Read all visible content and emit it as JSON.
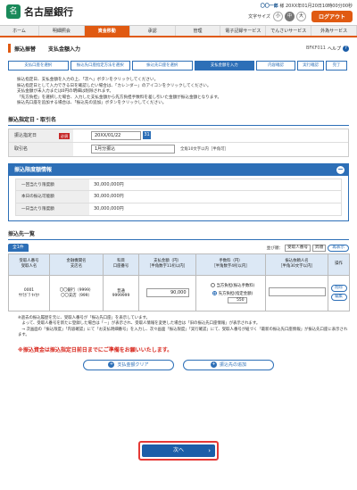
{
  "header": {
    "logo_mark": "名",
    "logo_text": "名古屋銀行",
    "user_name": "〇〇一郎",
    "user_suffix": "様",
    "last_login": "20XX年01月20日10時00分00秒",
    "font_size_label": "文字サイズ",
    "sizes": [
      "小",
      "中",
      "大"
    ],
    "active_size": "中",
    "logout_label": "ログアウト"
  },
  "gnav": {
    "items": [
      "ホーム",
      "明細照会",
      "資金移動",
      "承認",
      "管理",
      "電子記録サービス",
      "でんさいサービス",
      "外為サービス"
    ],
    "active": "資金移動"
  },
  "page": {
    "category": "振込振替",
    "title": "支払金額入力",
    "screen_code": "BFKF011",
    "help_label": "ヘルプ",
    "help_icon_glyph": "?"
  },
  "steps": [
    "支払口座を選択",
    "振込先口座指定方法を選択",
    "振込先口座を選択",
    "支払金額を入力",
    "内容確認",
    "実行確認",
    "完了"
  ],
  "current_step": 3,
  "instructions": [
    "振込指定日、支払金額を入力の上、「次へ」ボタンをクリックしてください。",
    "振込指定日として入力できる日を確認したい場合は、「カレンダー」のアイコンをクリックしてください。",
    "支払金額が未入力または0円の明細は削除されます。",
    "「先方負担」を選択した場合、入力した支払金額から先方負担手数料を差し引いた金額が振込金額となります。",
    "振込先口座を追加する場合は、「振込先の追加」ボタンをクリックしてください。"
  ],
  "date_section": {
    "heading": "振込指定日・取引名",
    "date_label": "振込指定日",
    "required_label": "必須",
    "date_value": "20XX/01/22",
    "calendar_icon_glyph": "31",
    "txn_label": "取引名",
    "txn_value": "1月分振込",
    "txn_note": "全角10文字以内［半角可］"
  },
  "limit_section": {
    "heading": "振込限度額情報",
    "toggle_glyph": "−",
    "rows": [
      {
        "label": "一回当たり限度額",
        "value": "30,000,000円"
      },
      {
        "label": "本日の振込可能額",
        "value": "30,000,000円"
      },
      {
        "label": "一日当たり限度額",
        "value": "30,000,000円"
      }
    ]
  },
  "payee_section": {
    "heading": "振込先一覧",
    "all_tab": "全1件",
    "sort_label": "並び順：",
    "sort_key": "受取人番号",
    "sort_order": "昇順",
    "resort_label": "再表示",
    "columns": [
      "受取人番号\n受取人名",
      "金融機関名\n支店名",
      "科目\n口座番号",
      "支払金額（円）\n［半角数字11桁以内］",
      "手数料（円）\n［半角数字4桁以内］",
      "振込依頼人名\n［半角30文字以内］",
      "操作"
    ],
    "rows": [
      {
        "payee_no": "0001",
        "payee_name": "ｻｸﾗｶﾞﾜ ｾｲｶﾂ",
        "bank": "〇〇銀行（9999）",
        "branch": "〇〇支店（999）",
        "type": "普通",
        "account": "9999999",
        "amount": "90,000",
        "fee_opt1": "当方負担(振込手数料)",
        "fee_opt2": "先方負担(指定金額)",
        "fee_value": "550",
        "requester": "",
        "ops": [
          "削除",
          "編集"
        ]
      }
    ]
  },
  "notes": [
    "※過去の振込履歴を元に、受取人番号が「振込先口座」を表示しています。",
    "　よって、受取人番号を新たに登録した場合は「－」が表示され、受取人情報を変更した場合は「旧の振込先口座情報」が表示されます。",
    "　→ 次画面の「振込限度」「内容確認」にて「お支払明細番号」を入力し、次々画面「振込限度」「実行確認」にて、受取人番号が紐づく「最新の振込先口座情報」が振込先口座に表示されます。"
  ],
  "warning": "※振込資金は振込指定日前日までにご準備をお願いいたします。",
  "buttons": {
    "clear_label": "支払金額クリア",
    "add_label": "振込先の追加",
    "next_label": "次へ",
    "plus_glyph": "+",
    "next_arrow_glyph": "›"
  },
  "colors": {
    "accent": "#e05a12",
    "primary": "#2d6fb7",
    "warning": "#d8261c",
    "highlight": "#e53935"
  }
}
